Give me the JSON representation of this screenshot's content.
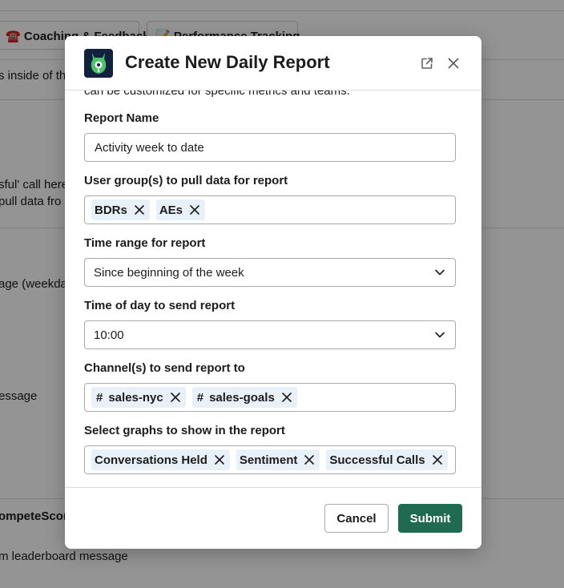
{
  "background": {
    "tabs": [
      {
        "icon": "☎️",
        "label": "Coaching & Feedback"
      },
      {
        "icon": "📝",
        "label": "Performance Tracking"
      }
    ],
    "texts": [
      "s inside of th",
      "sful' call here",
      " pull data fro",
      "age (weekday",
      "essage",
      "ompeteScor",
      "m leaderboard message"
    ]
  },
  "modal": {
    "title": "Create New Daily Report",
    "intro": "can be customized for specific metrics and teams.",
    "fields": {
      "report_name": {
        "label": "Report Name",
        "value": "Activity week to date"
      },
      "user_groups": {
        "label": "User group(s) to pull data for report",
        "chips": [
          "BDRs",
          "AEs"
        ]
      },
      "time_range": {
        "label": "Time range for report",
        "value": "Since beginning of the week"
      },
      "time_of_day": {
        "label": "Time of day to send report",
        "value": "10:00"
      },
      "channels": {
        "label": "Channel(s) to send report to",
        "chips": [
          "sales-nyc",
          "sales-goals"
        ]
      },
      "graphs": {
        "label": "Select graphs to show in the report",
        "chips": [
          "Conversations Held",
          "Sentiment",
          "Successful Calls"
        ]
      }
    },
    "footer": {
      "cancel_label": "Cancel",
      "submit_label": "Submit"
    }
  },
  "colors": {
    "submit_bg": "#1f6b52",
    "chip_bg": "#e8f1f8",
    "logo_bg": "#12213d",
    "logo_accent": "#4cc36a"
  },
  "icons": {
    "popout": "external-link-icon",
    "close": "close-icon",
    "chip_remove": "x-icon",
    "dropdown": "chevron-down-icon",
    "channel": "hash-icon"
  }
}
